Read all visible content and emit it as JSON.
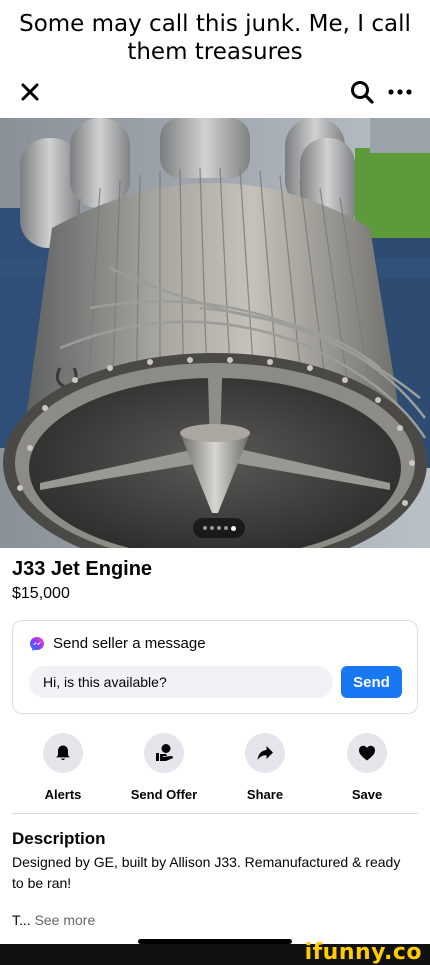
{
  "caption": {
    "line1": "Some may call this junk. Me, I call",
    "line2": "them treasures"
  },
  "toolbar": {
    "close_icon": "close-icon",
    "search_icon": "search-icon",
    "more_icon": "more-horizontal-icon"
  },
  "gallery": {
    "photo_count": 5,
    "active_index": 4
  },
  "listing": {
    "title": "J33 Jet Engine",
    "price": "$15,000"
  },
  "message": {
    "heading": "Send seller a message",
    "icon": "messenger-icon",
    "input_value": "Hi, is this available?",
    "send_label": "Send",
    "accent": "#1877f2"
  },
  "actions": [
    {
      "label": "Alerts",
      "icon": "bell-icon"
    },
    {
      "label": "Send Offer",
      "icon": "offer-hand-icon"
    },
    {
      "label": "Share",
      "icon": "share-arrow-icon"
    },
    {
      "label": "Save",
      "icon": "heart-icon"
    }
  ],
  "description": {
    "heading": "Description",
    "text": "Designed by GE, built by Allison J33. Remanufactured & ready to be ran!",
    "truncated": "T...",
    "see_more": "See more"
  },
  "watermark": "ifunny.co"
}
